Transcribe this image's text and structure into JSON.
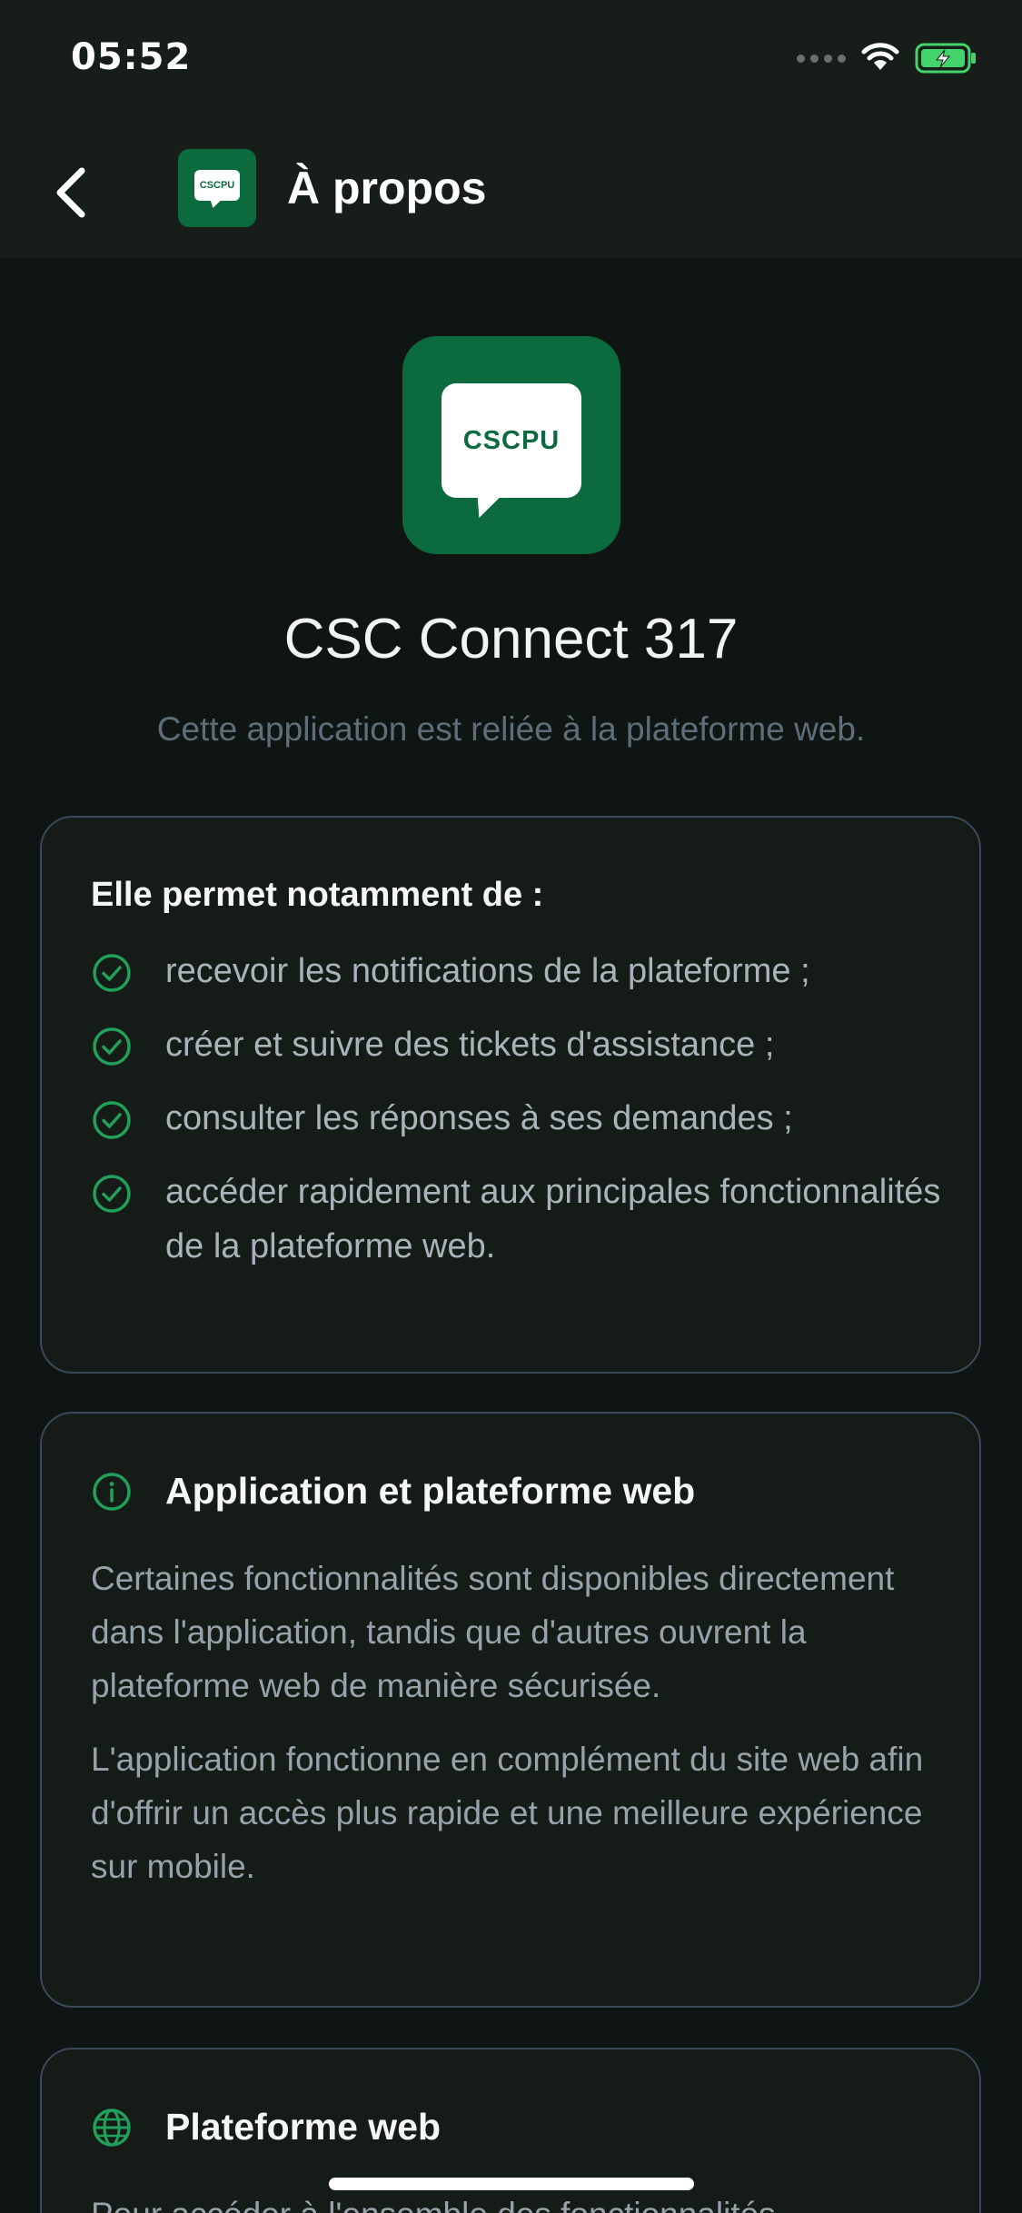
{
  "status_bar": {
    "time": "05:52"
  },
  "nav": {
    "title": "À propos",
    "logo_text": "CSCPU"
  },
  "app": {
    "logo_text": "CSCPU",
    "name": "CSC Connect 317",
    "tagline": "Cette application est reliée à la plateforme web."
  },
  "features": {
    "heading": "Elle permet notamment de :",
    "items": [
      "recevoir les notifications de la plateforme ;",
      "créer et suivre des tickets d'assistance ;",
      "consulter les réponses à ses demandes ;",
      "accéder rapidement aux principales fonctionnalités de la plateforme web."
    ]
  },
  "info_card": {
    "title": "Application et plateforme web",
    "paragraphs": [
      "Certaines fonctionnalités sont disponibles directement dans l'application, tandis que d'autres ouvrent la plateforme web de manière sécurisée.",
      "L'application fonctionne en complément du site web afin d'offrir un accès plus rapide et une meilleure expérience sur mobile."
    ]
  },
  "web_card": {
    "title": "Plateforme web",
    "body": "Pour accéder à l'ensemble des fonctionnalités"
  },
  "icons": {
    "back": "chevron-left-icon",
    "check": "check-circle-icon",
    "info": "info-circle-icon",
    "globe": "globe-icon",
    "wifi": "wifi-icon",
    "battery": "battery-charging-icon"
  },
  "colors": {
    "accent_green": "#22a05a",
    "logo_green": "#0b6a3e",
    "background": "#0f1512",
    "card_border": "#394a58"
  }
}
